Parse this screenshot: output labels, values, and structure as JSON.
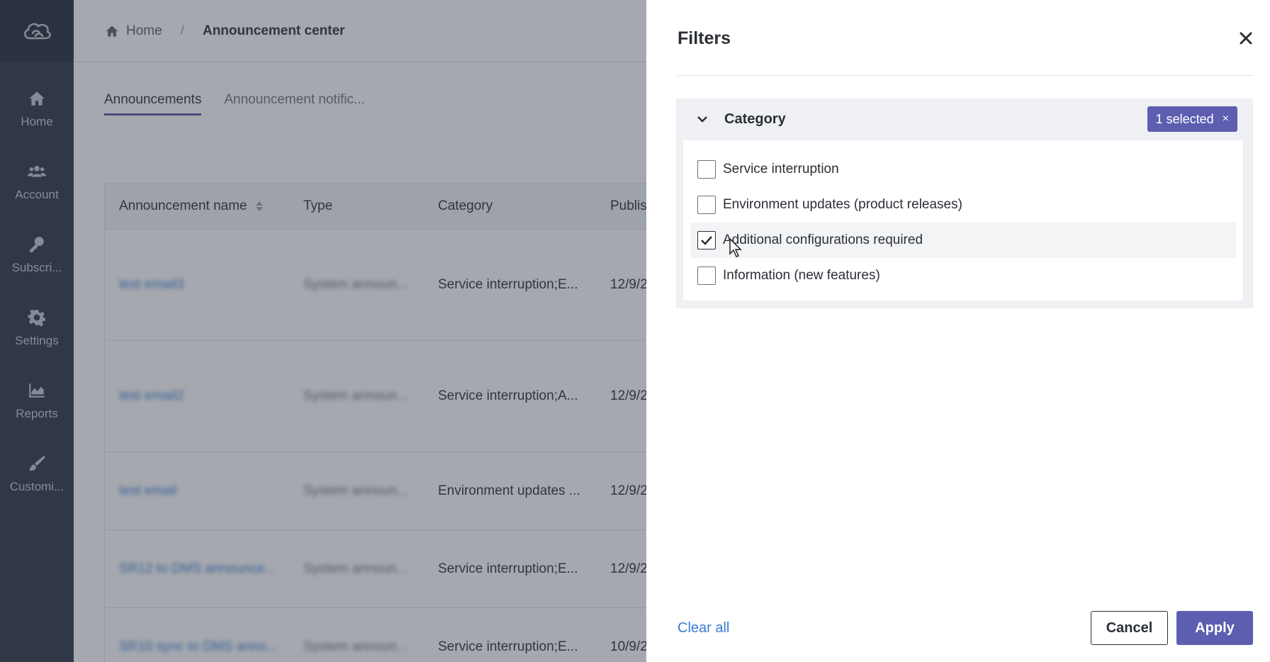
{
  "sidebar": {
    "items": [
      {
        "label": "Home",
        "icon": "home-icon"
      },
      {
        "label": "Account",
        "icon": "users-icon"
      },
      {
        "label": "Subscri...",
        "icon": "key-icon"
      },
      {
        "label": "Settings",
        "icon": "gear-icon"
      },
      {
        "label": "Reports",
        "icon": "chart-icon"
      },
      {
        "label": "Customi...",
        "icon": "brush-icon"
      }
    ]
  },
  "breadcrumb": {
    "home": "Home",
    "separator": "/",
    "current": "Announcement center"
  },
  "tabs": [
    {
      "label": "Announcements",
      "active": true
    },
    {
      "label": "Announcement notific...",
      "active": false
    }
  ],
  "table": {
    "headers": [
      "Announcement name",
      "Type",
      "Category",
      "Publis"
    ],
    "rows": [
      {
        "name": "test email3",
        "type": "System announ...",
        "category": "Service interruption;E...",
        "published": "12/9/2"
      },
      {
        "name": "test email2",
        "type": "System announ...",
        "category": "Service interruption;A...",
        "published": "12/9/2"
      },
      {
        "name": "test email",
        "type": "System announ...",
        "category": "Environment updates ...",
        "published": "12/9/2"
      },
      {
        "name": "SR12 to DMS announce...",
        "type": "System announ...",
        "category": "Service interruption;E...",
        "published": "12/9/2"
      },
      {
        "name": "SR10 sync to DMS anno...",
        "type": "System announ...",
        "category": "Service interruption;E...",
        "published": "10/9/2"
      }
    ]
  },
  "filters": {
    "title": "Filters",
    "section": {
      "title": "Category",
      "badge": "1 selected",
      "badge_close": "×",
      "options": [
        {
          "label": "Service interruption",
          "checked": false
        },
        {
          "label": "Environment updates (product releases)",
          "checked": false
        },
        {
          "label": "Additional configurations required",
          "checked": true
        },
        {
          "label": "Information (new features)",
          "checked": false
        }
      ]
    },
    "clear_all": "Clear all",
    "cancel": "Cancel",
    "apply": "Apply"
  },
  "colors": {
    "sidebar_bg": "#2a3446",
    "accent": "#5d5eb0",
    "link": "#3a7bd5"
  }
}
